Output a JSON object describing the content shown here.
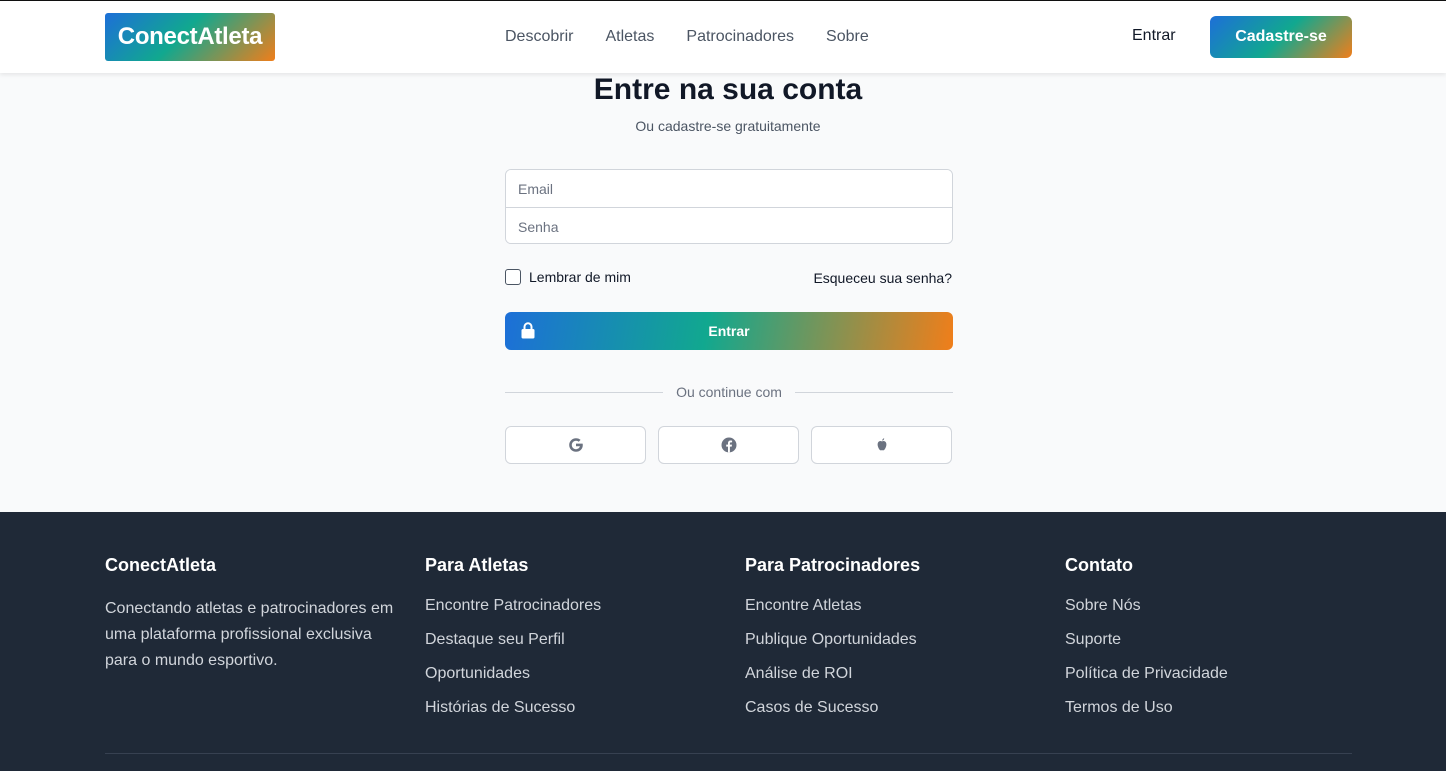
{
  "header": {
    "logo": "ConectAtleta",
    "nav": [
      "Descobrir",
      "Atletas",
      "Patrocinadores",
      "Sobre"
    ],
    "login_label": "Entrar",
    "signup_label": "Cadastre-se"
  },
  "login": {
    "title": "Entre na sua conta",
    "subtitle": "Ou cadastre-se gratuitamente",
    "email_placeholder": "Email",
    "password_placeholder": "Senha",
    "remember_label": "Lembrar de mim",
    "remember_checked": false,
    "forgot_label": "Esqueceu sua senha?",
    "submit_label": "Entrar",
    "divider_label": "Ou continue com",
    "social": [
      "google-icon",
      "facebook-icon",
      "apple-icon"
    ]
  },
  "footer": {
    "brand": {
      "title": "ConectAtleta",
      "description": "Conectando atletas e patrocinadores em uma plataforma profissional exclusiva para o mundo esportivo."
    },
    "athletes": {
      "title": "Para Atletas",
      "links": [
        "Encontre Patrocinadores",
        "Destaque seu Perfil",
        "Oportunidades",
        "Histórias de Sucesso"
      ]
    },
    "sponsors": {
      "title": "Para Patrocinadores",
      "links": [
        "Encontre Atletas",
        "Publique Oportunidades",
        "Análise de ROI",
        "Casos de Sucesso"
      ]
    },
    "contact": {
      "title": "Contato",
      "links": [
        "Sobre Nós",
        "Suporte",
        "Política de Privacidade",
        "Termos de Uso"
      ]
    }
  },
  "colors": {
    "gradient_start": "#1d6fd8",
    "gradient_mid": "#11a88f",
    "gradient_end": "#f07e1a",
    "footer_bg": "#1f2937"
  }
}
